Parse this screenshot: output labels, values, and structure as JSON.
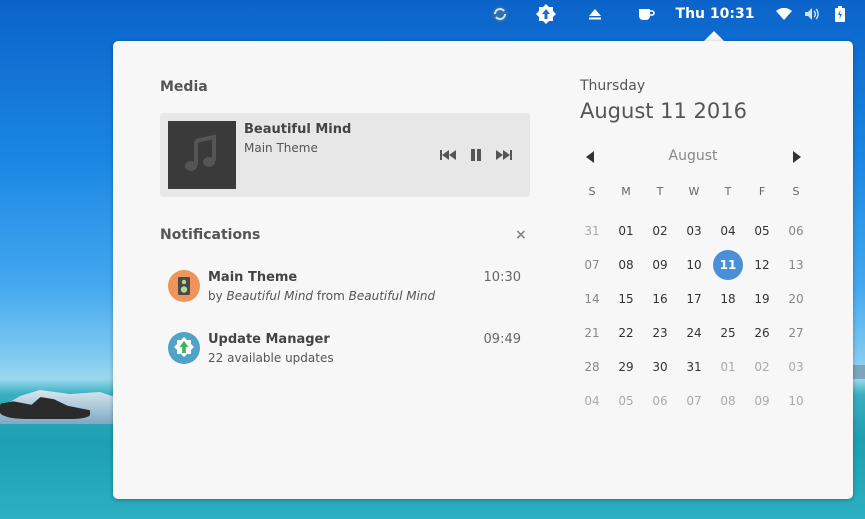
{
  "topbar": {
    "clock": "Thu 10:31"
  },
  "media": {
    "section_title": "Media",
    "track_title": "Beautiful Mind",
    "track_subtitle": "Main Theme"
  },
  "notifications": {
    "section_title": "Notifications",
    "clear_label": "×",
    "items": [
      {
        "title": "Main Theme",
        "by": "by",
        "artist": "Beautiful Mind",
        "from": "from",
        "album": "Beautiful Mind",
        "time": "10:30",
        "icon": "music-player-icon",
        "icon_color": "#f0955a"
      },
      {
        "title": "Update Manager",
        "body": "22 available updates",
        "time": "09:49",
        "icon": "update-manager-icon",
        "icon_color": "#4fa3c9"
      }
    ]
  },
  "calendar": {
    "weekday": "Thursday",
    "date": "August 11 2016",
    "month": "August",
    "day_headers": [
      "S",
      "M",
      "T",
      "W",
      "T",
      "F",
      "S"
    ],
    "weeks": [
      [
        "31",
        "01",
        "02",
        "03",
        "04",
        "05",
        "06"
      ],
      [
        "07",
        "08",
        "09",
        "10",
        "11",
        "12",
        "13"
      ],
      [
        "14",
        "15",
        "16",
        "17",
        "18",
        "19",
        "20"
      ],
      [
        "21",
        "22",
        "23",
        "24",
        "25",
        "26",
        "27"
      ],
      [
        "28",
        "29",
        "30",
        "31",
        "01",
        "02",
        "03"
      ],
      [
        "04",
        "05",
        "06",
        "07",
        "08",
        "09",
        "10"
      ]
    ],
    "today": "11",
    "accent_color": "#4a90d9"
  }
}
